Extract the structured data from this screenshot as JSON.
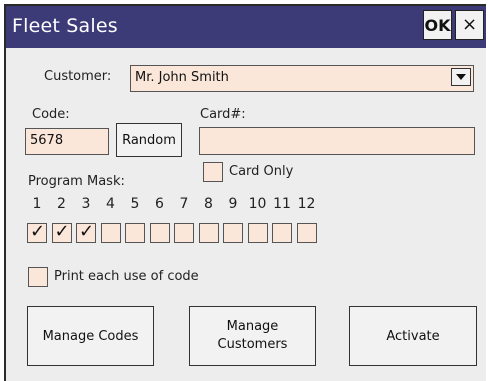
{
  "window": {
    "title": "Fleet Sales",
    "ok_label": "OK",
    "close_label": "×"
  },
  "customer": {
    "label": "Customer:",
    "value": "Mr. John Smith"
  },
  "code": {
    "label": "Code:",
    "value": "5678",
    "random_label": "Random"
  },
  "card": {
    "label": "Card#:",
    "value": "",
    "card_only_label": "Card Only",
    "card_only_checked": false
  },
  "program_mask": {
    "label": "Program Mask:",
    "numbers": [
      "1",
      "2",
      "3",
      "4",
      "5",
      "6",
      "7",
      "8",
      "9",
      "10",
      "11",
      "12"
    ],
    "checked": [
      true,
      true,
      true,
      false,
      false,
      false,
      false,
      false,
      false,
      false,
      false,
      false
    ]
  },
  "print_each_use": {
    "label": "Print each use of code",
    "checked": false
  },
  "buttons": {
    "manage_codes": "Manage Codes",
    "manage_customers": "Manage\nCustomers",
    "activate": "Activate"
  }
}
